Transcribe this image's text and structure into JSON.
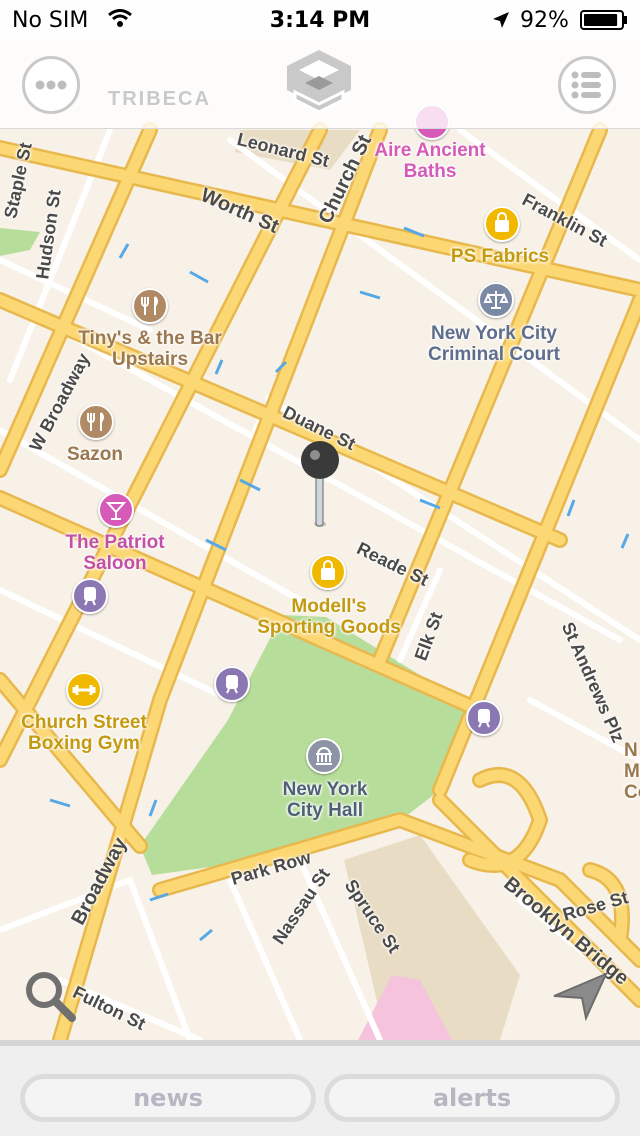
{
  "status_bar": {
    "carrier": "No SIM",
    "time": "3:14 PM",
    "battery": "92%",
    "battery_level": 0.92
  },
  "map": {
    "neighborhood": "TRIBECA",
    "streets": {
      "leonard": "Leonard St",
      "church": "Church St",
      "worth": "Worth St",
      "franklin": "Franklin St",
      "hudson": "Hudson St",
      "staple": "Staple St",
      "w_broadway": "W Broadway",
      "duane": "Duane St",
      "reade": "Reade St",
      "elk": "Elk St",
      "st_andrews": "St Andrews Plz",
      "broadway": "Broadway",
      "park_row": "Park Row",
      "nassau": "Nassau St",
      "spruce": "Spruce St",
      "brooklyn_bridge": "Brooklyn Bridge",
      "rose": "Rose St",
      "fulton": "Fulton St"
    },
    "pois": {
      "aire": [
        "Aire Ancient",
        "Baths"
      ],
      "ps_fabrics": [
        "PS Fabrics"
      ],
      "court": [
        "New York City",
        "Criminal Court"
      ],
      "tinys": [
        "Tiny's & the Bar",
        "Upstairs"
      ],
      "sazon": [
        "Sazon"
      ],
      "patriot": [
        "The Patriot",
        "Saloon"
      ],
      "modells": [
        "Modell's",
        "Sporting Goods"
      ],
      "boxing": [
        "Church Street",
        "Boxing Gym"
      ],
      "city_hall": [
        "New York",
        "City Hall"
      ],
      "edge": [
        "N",
        "Me",
        "Co"
      ]
    },
    "icons": {
      "spa": "spa-icon",
      "shopping": "shopping-bag-icon",
      "court": "scales-icon",
      "restaurant": "fork-knife-icon",
      "bar": "cocktail-icon",
      "transit": "train-icon",
      "gym": "dumbbell-icon",
      "landmark": "capitol-icon"
    },
    "colors": {
      "spa": "#d65bb8",
      "shopping": "#f1b800",
      "court": "#7a8aa5",
      "restaurant": "#b08a64",
      "bar": "#d65bb8",
      "transit": "#8b78b3",
      "gym": "#f1b800",
      "landmark": "#8c94a6",
      "road": "#fcd875",
      "road_edge": "#e8b84d",
      "park": "#b7dd9b",
      "land": "#f7f1e7"
    }
  },
  "bottom_bar": {
    "news": "news",
    "alerts": "alerts"
  }
}
